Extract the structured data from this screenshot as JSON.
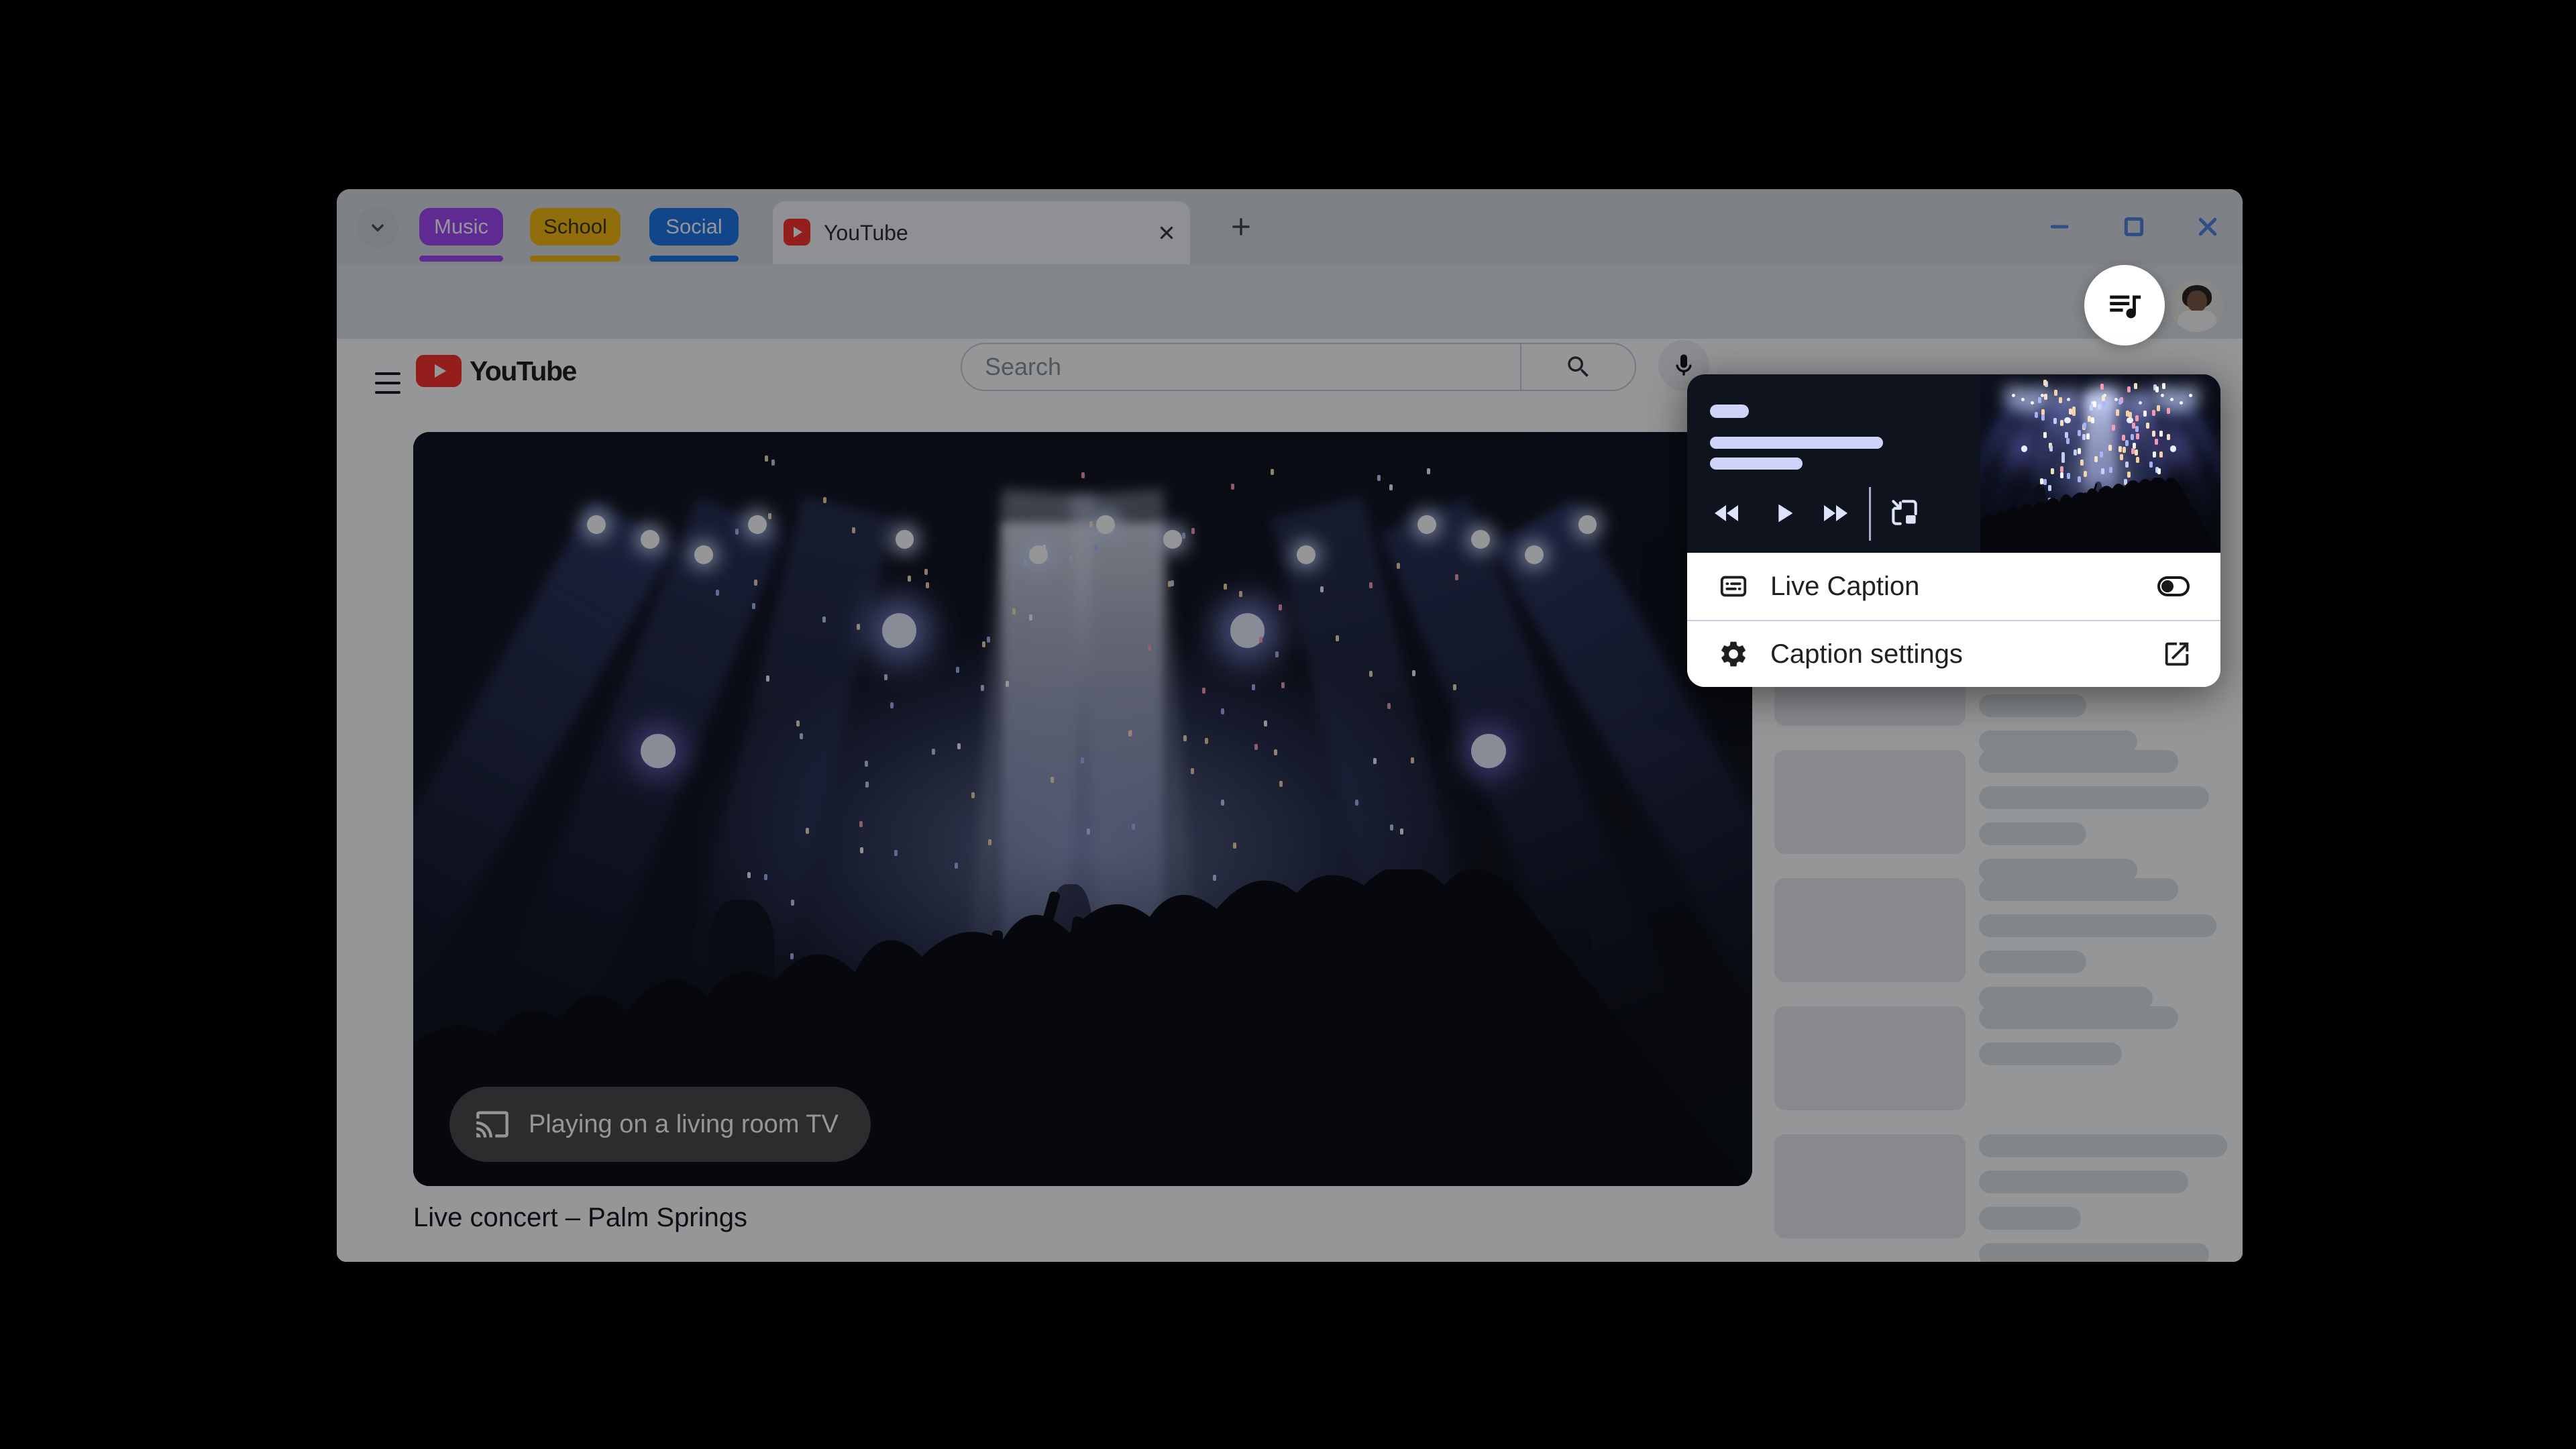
{
  "browser": {
    "tab_groups": [
      {
        "label": "Music",
        "color": "#a142f4"
      },
      {
        "label": "School",
        "color": "#f5b90a"
      },
      {
        "label": "Social",
        "color": "#1a73e8"
      }
    ],
    "active_tab": {
      "title": "YouTube"
    },
    "url": "youtube.com/watch/"
  },
  "youtube": {
    "search_placeholder": "Search",
    "video_title": "Live concert – Palm Springs",
    "cast_status": "Playing on a living room TV"
  },
  "media_popup": {
    "live_caption": {
      "label": "Live Caption",
      "enabled": false
    },
    "caption_settings": {
      "label": "Caption settings"
    }
  },
  "sidebar": {
    "items": [
      {
        "bars": [
          0.72,
          0.9,
          0.42,
          0.62
        ]
      },
      {
        "bars": [
          0.78,
          0.9,
          0.42,
          0.62
        ]
      },
      {
        "bars": [
          0.78,
          0.93,
          0.42,
          0.68
        ]
      },
      {
        "bars": [
          0.78,
          0.56
        ]
      },
      {
        "bars": [
          0.97,
          0.82,
          0.4,
          0.9
        ]
      },
      {
        "bars": [
          0.85,
          0.85,
          0.4
        ]
      }
    ]
  },
  "colors": {
    "youtube_red": "#fe2c25",
    "popup_media_bg": "#0e131e",
    "placeholder_lavender": "#cdd4f8",
    "window_control_blue": "#4d7fe3",
    "scrim": "rgba(10,11,14,0.43)"
  }
}
